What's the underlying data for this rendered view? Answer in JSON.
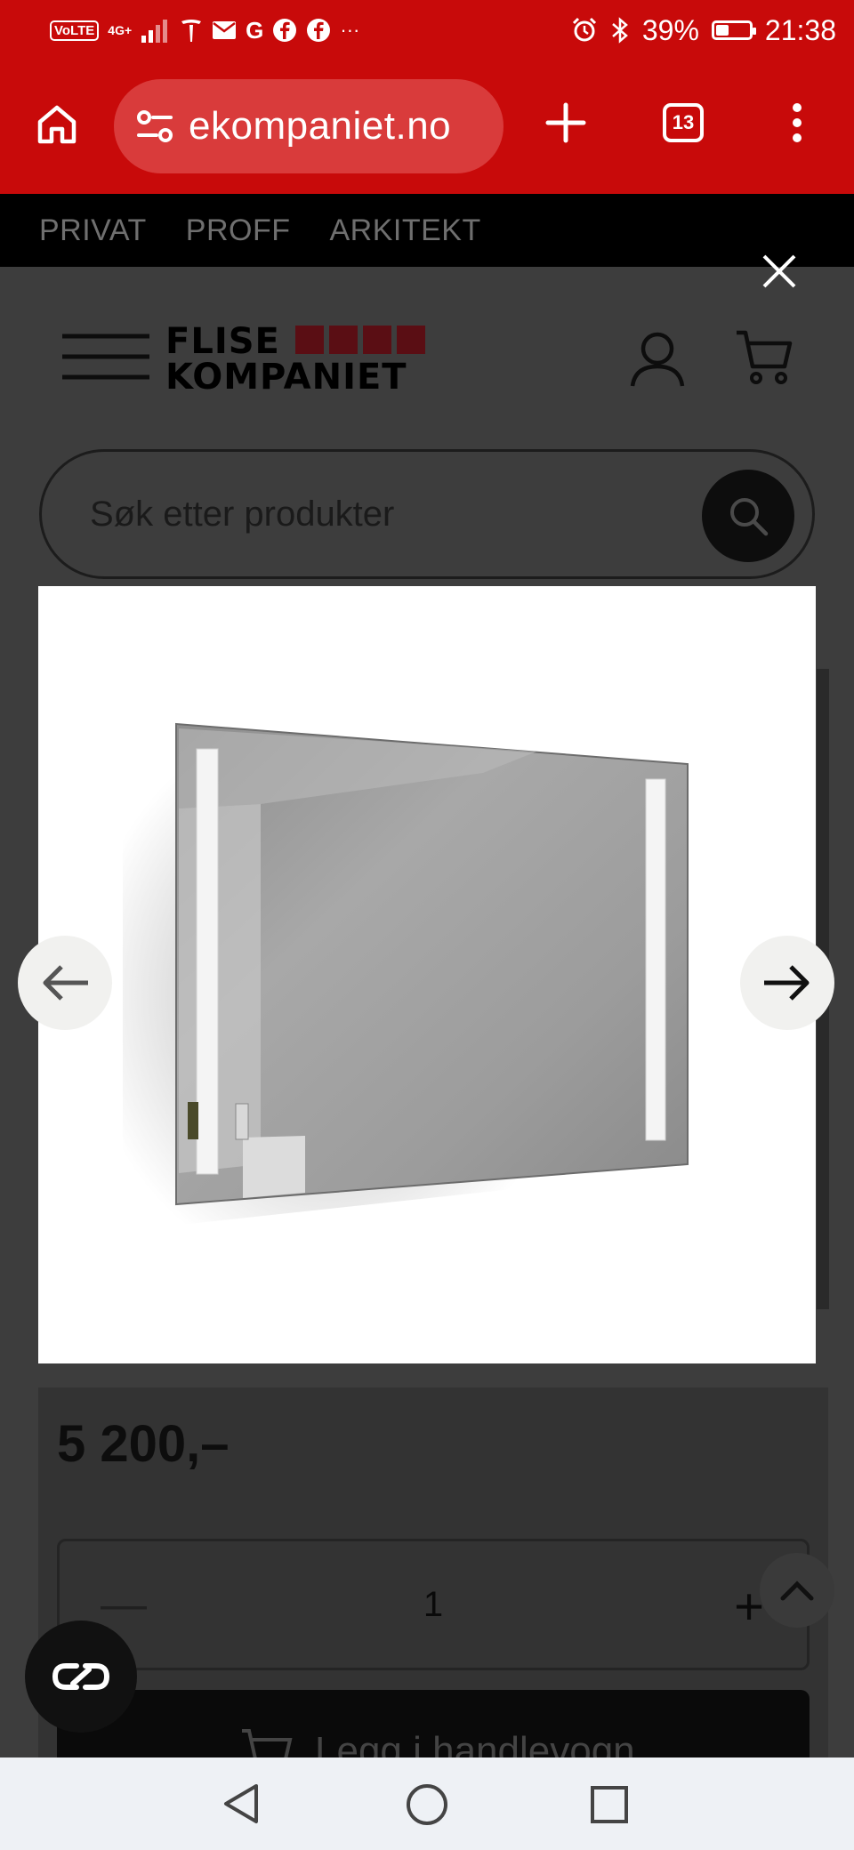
{
  "status_bar": {
    "left": {
      "volte": "VoLTE",
      "network": "4G+",
      "extra": "···"
    },
    "battery_percent": "39%",
    "battery_level": 0.39,
    "time": "21:38"
  },
  "browser": {
    "url": "ekompaniet.no",
    "tab_count": "13"
  },
  "top_nav": [
    "PRIVAT",
    "PROFF",
    "ARKITEKT"
  ],
  "header": {
    "logo_line1": "FLISE",
    "logo_line2": "KOMPANIET",
    "logo_color": "#5a0e14"
  },
  "search": {
    "placeholder": "Søk etter produkter"
  },
  "product": {
    "price": "5 200,–",
    "quantity": "1",
    "qty_minus": "—",
    "qty_plus": "+",
    "add_to_cart": "Legg i handlevogn"
  },
  "colors": {
    "browser_red": "#c80a0a",
    "overlay_dark": "#3d3d3d"
  }
}
